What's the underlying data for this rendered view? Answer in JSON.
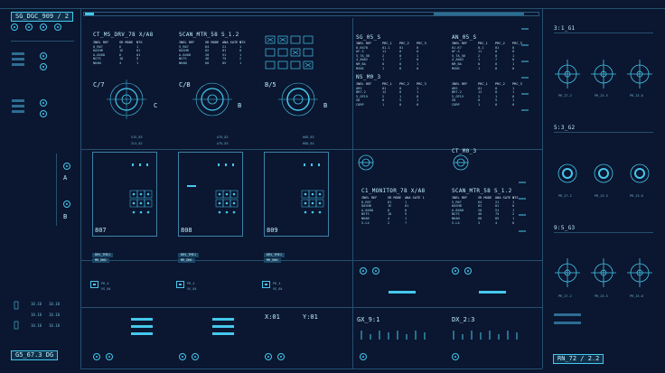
{
  "top_left_label": "SG_DGC_909 / 2",
  "bottom_left_label": "G5_67.3 DG",
  "top_right_label": "3:1_G1",
  "bottom_right_label": "RN_72 / 2.2",
  "left_col_labels": [
    "A",
    "B"
  ],
  "right_section_titles": [
    "3:1_G1",
    "5:3_G2",
    "9:5_G3"
  ],
  "right_gauge_labels": [
    "PR_27.2",
    "PR_23.5",
    "PR_23.0"
  ],
  "row1_titles": [
    "CT_MS_DRV_78 X/A8",
    "SCAN_MTR_58 S_1.2",
    "SG_05_S",
    "AN_05_S"
  ],
  "mid_subtitles": [
    "NS_M0_3",
    "CT_M0_3"
  ],
  "dial_titles": [
    "C/7",
    "C/B",
    "B/5"
  ],
  "dial_letters": [
    "C",
    "B",
    "B"
  ],
  "dial_bottom_labels": [
    [
      "SJS_83",
      "IC4_02"
    ],
    [
      "ATU_82",
      "ATU_83"
    ],
    [
      "HOD_83",
      "HOD_84"
    ]
  ],
  "bay_numbers": [
    "807",
    "808",
    "809"
  ],
  "bay_tags": [
    [
      "DRV_TMEJ",
      "MR_DNG"
    ],
    [
      "DRV_TMEJ",
      "MR_DNG"
    ],
    [
      "DRV_TMEJ",
      "MR_DNG"
    ]
  ],
  "bay_meta": [
    [
      "PR_4",
      "VS_84"
    ],
    [
      "PR_4",
      "VS_84"
    ],
    [
      "PR_4",
      "VS_84"
    ]
  ],
  "mid_right_titles": [
    "C1_MONITOR_78 X/A8",
    "SCAN_MTR_58 S_1.2"
  ],
  "coord_labels": [
    "X:01",
    "Y:01"
  ],
  "gx_labels": [
    "GX_9:1",
    "DX_2:3"
  ],
  "table_a": {
    "headers": [
      "INEL REF",
      "SR MODE",
      "NTS"
    ],
    "rows": [
      [
        "0_R07",
        "6",
        "1"
      ],
      [
        "DASHB",
        "1E",
        "01"
      ],
      [
        "A-8408",
        "6",
        "01"
      ],
      [
        "NSTS",
        "1D",
        "5"
      ],
      [
        "NHAN",
        "4",
        "1"
      ]
    ]
  },
  "table_b": {
    "headers": [
      "INEL REF",
      "SR MODE",
      "ANA SATE 1",
      "NTS"
    ],
    "rows": [
      [
        "5_R07",
        "64",
        "21",
        "1"
      ],
      [
        "DASHB",
        "02",
        "01",
        "0"
      ],
      [
        "A-8408",
        "20",
        "51",
        "1"
      ],
      [
        "NSTS",
        "46",
        "75",
        "2"
      ],
      [
        "NHAN",
        "60",
        "85",
        "1"
      ]
    ]
  },
  "table_c": {
    "headers": [
      "INEL REF",
      "PRC_1",
      "PRC_2",
      "PRC_3"
    ],
    "rows": [
      [
        "8-6470",
        "01-1",
        "01",
        "0"
      ],
      [
        "AF-S",
        "11",
        "0",
        "0"
      ],
      [
        "5_TA_56",
        "2",
        "0",
        "1"
      ],
      [
        "4_A002",
        "1",
        "7",
        "0"
      ],
      [
        "NM_BA",
        "0",
        "0",
        "1"
      ],
      [
        "MSNS",
        "1",
        "8",
        "0"
      ]
    ]
  },
  "table_d": {
    "headers": [
      "INEL REF",
      "PRC_1",
      "PRC_2",
      "PRC_3"
    ],
    "rows": [
      [
        "01-K7",
        "0-1",
        "01",
        "0"
      ],
      [
        "AF-S",
        "11",
        "0",
        "0"
      ],
      [
        "5_TA_56",
        "2",
        "0",
        "1"
      ],
      [
        "4_A002",
        "1",
        "7",
        "0"
      ],
      [
        "NM_BA",
        "0",
        "0",
        "1"
      ],
      [
        "MSNS",
        "1",
        "8",
        "0"
      ]
    ]
  },
  "table_e": {
    "headers": [
      "INEL REF",
      "PRC_1",
      "PRC_2",
      "PRC_3"
    ],
    "rows": [
      [
        "ARS",
        "01",
        "0",
        "1"
      ],
      [
        "BRT-2",
        "12",
        "0",
        "1"
      ],
      [
        "5_GP15",
        "2",
        "1",
        "0"
      ],
      [
        "SD",
        "0",
        "5",
        "1"
      ],
      [
        "CORP",
        "1",
        "0",
        "0"
      ]
    ]
  },
  "table_f": {
    "headers": [
      "INEL REF",
      "PRC_1",
      "PRC_2",
      "PRC_3"
    ],
    "rows": [
      [
        "ARS",
        "01",
        "0",
        "1"
      ],
      [
        "BRT-2",
        "12",
        "0",
        "1"
      ],
      [
        "5_GP15",
        "2",
        "1",
        "0"
      ],
      [
        "SD",
        "0",
        "5",
        "1"
      ],
      [
        "CORP",
        "1",
        "0",
        "0"
      ]
    ]
  },
  "table_g": {
    "headers": [
      "INEL REF",
      "SR MODE",
      "ANA SATE 1"
    ],
    "rows": [
      [
        "0_R07",
        "61",
        "1"
      ],
      [
        "DASHB",
        "1E",
        "01"
      ],
      [
        "A-8408",
        "6",
        "0"
      ],
      [
        "NSTS",
        "1D",
        "5"
      ],
      [
        "NHAN",
        "4",
        "1"
      ],
      [
        "S-L4",
        "2",
        "7"
      ]
    ]
  },
  "table_h": {
    "headers": [
      "INEL REF",
      "SR MODE",
      "ANA SATE 1",
      "NTS"
    ],
    "rows": [
      [
        "5_R07",
        "64",
        "21",
        "1"
      ],
      [
        "DASHB",
        "02",
        "01",
        "0"
      ],
      [
        "A-8408",
        "20",
        "51",
        "1"
      ],
      [
        "NSTS",
        "46",
        "75",
        "2"
      ],
      [
        "NHAN",
        "60",
        "85",
        "1"
      ],
      [
        "S-L4",
        "3",
        "4",
        "0"
      ]
    ]
  },
  "colors": {
    "bg": "#0b1630",
    "accent": "#45c8ec",
    "line": "#25506e"
  }
}
